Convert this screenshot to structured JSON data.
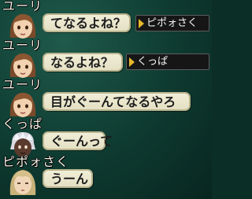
{
  "messages": [
    {
      "speaker": "ユーリ",
      "avatar": "yuri-avatar",
      "text": "てなるよね？",
      "target": "ピポォさく"
    },
    {
      "speaker": "ユーリ",
      "avatar": "yuri-avatar",
      "text": "なるよね？",
      "target": "くっぱ"
    },
    {
      "speaker": "ユーリ",
      "avatar": "yuri-avatar",
      "text": "目がぐーんてなるやろ",
      "target": ""
    },
    {
      "speaker": "くっぱ",
      "avatar": "kuppa-avatar",
      "text": "ぐーんって",
      "target": ""
    },
    {
      "speaker": "ピポォさく",
      "avatar": "pipo-avatar",
      "text": "うーん",
      "target": ""
    }
  ],
  "colors": {
    "background": "#0e3a30",
    "bubble": "#efeccf",
    "tag_background": "#161616",
    "tag_arrow": "#e6b92c"
  }
}
